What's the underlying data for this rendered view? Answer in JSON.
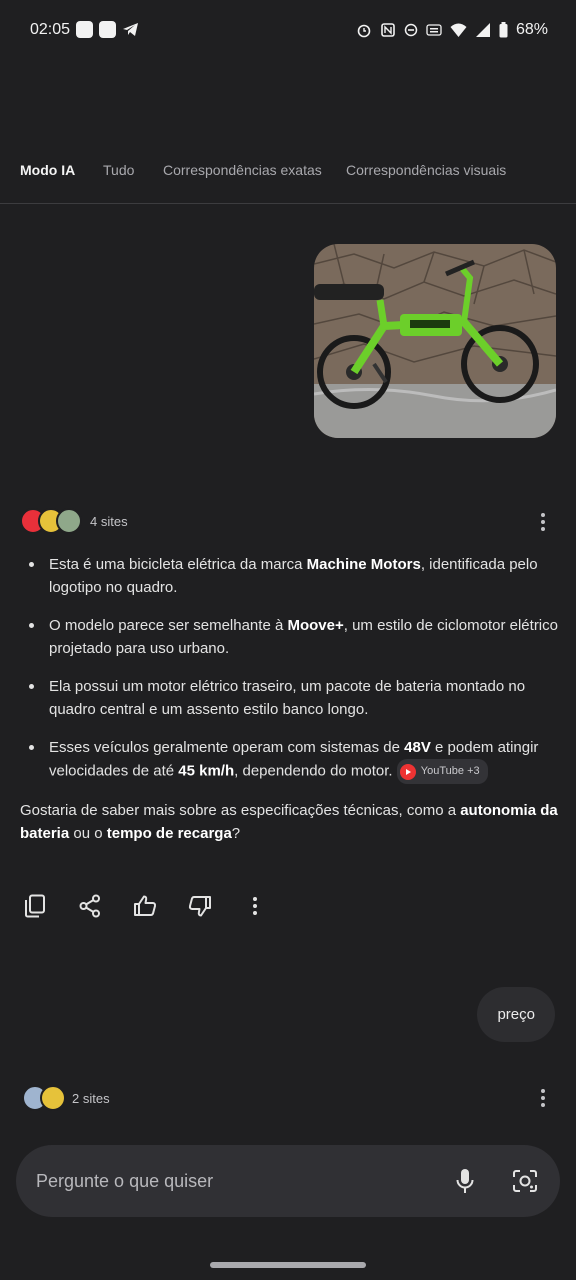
{
  "status_bar": {
    "time": "02:05",
    "battery": "68%"
  },
  "tabs": [
    {
      "label": "Modo IA"
    },
    {
      "label": "Tudo"
    },
    {
      "label": "Correspondências exatas"
    },
    {
      "label": "Correspondências visuais"
    }
  ],
  "sources_1": {
    "count_text": "4 sites"
  },
  "answer": {
    "bullet1": {
      "pre": "Esta é uma bicicleta elétrica da marca ",
      "bold": "Machine Motors",
      "post": ", identificada pelo logotipo no quadro."
    },
    "bullet2": {
      "pre": "O modelo parece ser semelhante à ",
      "bold": "Moove+",
      "post": ", um estilo de ciclomotor elétrico projetado para uso urbano."
    },
    "bullet3": {
      "text": "Ela possui um motor elétrico traseiro, um pacote de bateria montado no quadro central e um assento estilo banco longo."
    },
    "bullet4": {
      "pre": "Esses veículos geralmente operam com sistemas de ",
      "bold1": "48V",
      "mid": " e podem atingir velocidades de até ",
      "bold2": "45 km/h",
      "post": ", dependendo do motor. ",
      "chip": "YouTube +3"
    },
    "followup": {
      "pre": "Gostaria de saber mais sobre as especificações técnicas, como a ",
      "bold1": "autonomia da bateria",
      "mid": " ou o ",
      "bold2": "tempo de recarga",
      "post": "?"
    }
  },
  "user_message": "preço",
  "sources_2": {
    "count_text": "2 sites"
  },
  "input": {
    "placeholder": "Pergunte o que quiser"
  },
  "colors": {
    "background": "#1f1f21",
    "accent_green": "#6ccf2a",
    "youtube_red": "#e33333"
  }
}
